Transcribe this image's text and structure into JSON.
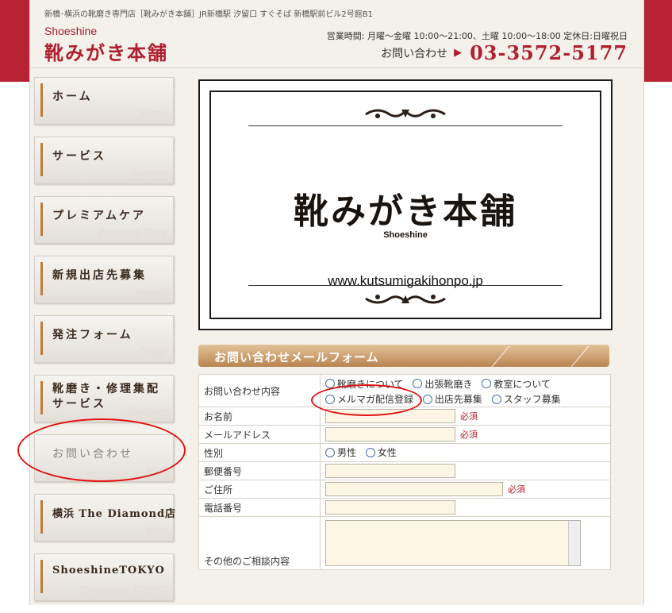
{
  "header": {
    "topline": "新橋･横浜の靴磨き専門店［靴みがき本舗］JR新橋駅 汐留口 すぐそば 新橋駅前ビル2号館B1",
    "brand_small": "Shoeshine",
    "brand": "靴みがき本舗",
    "hours": "営業時間: 月曜～金曜 10:00～21:00、土曜 10:00～18:00 定休日:日曜祝日",
    "contact_label": "お問い合わせ",
    "phone": "03-3572-5177",
    "accent": "#b0202e"
  },
  "nav": {
    "items": [
      {
        "label": "ホーム",
        "en": "Home"
      },
      {
        "label": "サービス",
        "en": "Service"
      },
      {
        "label": "プレミアムケア",
        "en": "Premium Care"
      },
      {
        "label": "新規出店先募集",
        "en": "tenant"
      },
      {
        "label": "発注フォーム",
        "en": "Order"
      },
      {
        "label": "靴磨き・修理集配",
        "label2": "サービス",
        "en": "Delivery"
      },
      {
        "label": "お問い合わせ",
        "en": "Mail"
      },
      {
        "label": "横浜 The Diamond店",
        "en": "Map"
      },
      {
        "label": "ShoeshineTOKYO",
        "en": "Shoeshine TOKYO"
      }
    ]
  },
  "banner": {
    "title": "靴みがき本舗",
    "sub": "Shoeshine",
    "url": "www.kutsumigakihonpo.jp"
  },
  "form": {
    "heading": "お問い合わせメールフォーム",
    "rows": {
      "inquiry": {
        "label": "お問い合わせ内容",
        "options": [
          "靴磨きについて",
          "出張靴磨き",
          "教室について",
          "メルマガ配信登録",
          "出店先募集",
          "スタッフ募集"
        ]
      },
      "name": {
        "label": "お名前",
        "required": "必須"
      },
      "email": {
        "label": "メールアドレス",
        "required": "必須"
      },
      "gender": {
        "label": "性別",
        "options": [
          "男性",
          "女性"
        ]
      },
      "zip": {
        "label": "郵便番号"
      },
      "address": {
        "label": "ご住所",
        "required": "必須"
      },
      "phone": {
        "label": "電話番号"
      },
      "other": {
        "label": "その他のご相談内容"
      }
    }
  }
}
